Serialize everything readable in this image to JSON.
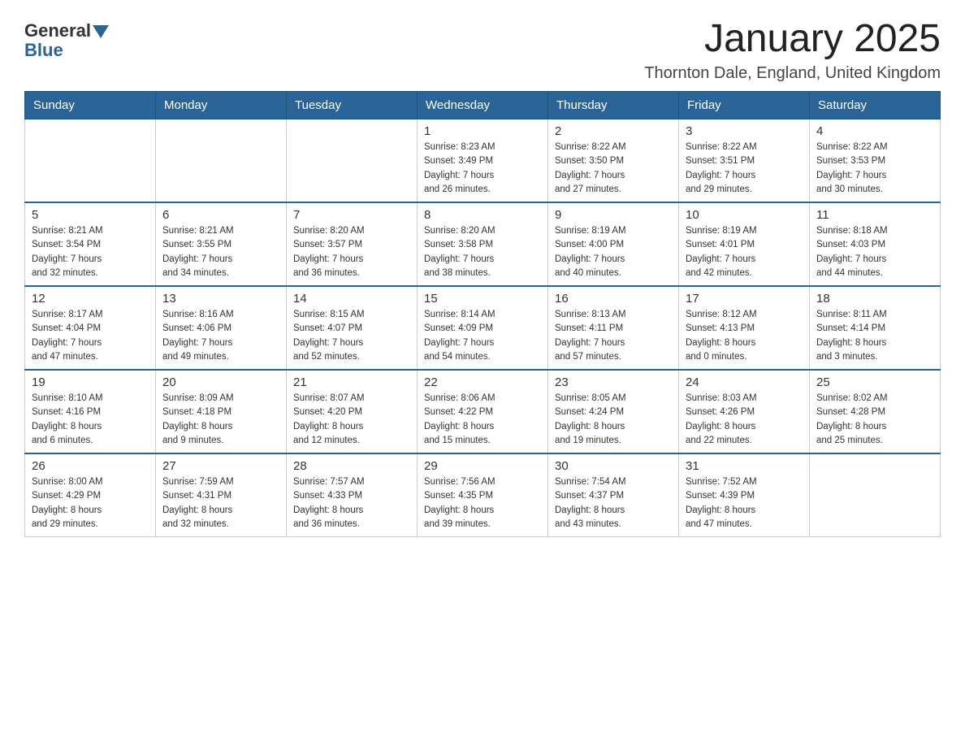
{
  "header": {
    "logo": {
      "general": "General",
      "blue": "Blue"
    },
    "title": "January 2025",
    "location": "Thornton Dale, England, United Kingdom"
  },
  "weekdays": [
    "Sunday",
    "Monday",
    "Tuesday",
    "Wednesday",
    "Thursday",
    "Friday",
    "Saturday"
  ],
  "weeks": [
    [
      {
        "day": "",
        "info": ""
      },
      {
        "day": "",
        "info": ""
      },
      {
        "day": "",
        "info": ""
      },
      {
        "day": "1",
        "info": "Sunrise: 8:23 AM\nSunset: 3:49 PM\nDaylight: 7 hours\nand 26 minutes."
      },
      {
        "day": "2",
        "info": "Sunrise: 8:22 AM\nSunset: 3:50 PM\nDaylight: 7 hours\nand 27 minutes."
      },
      {
        "day": "3",
        "info": "Sunrise: 8:22 AM\nSunset: 3:51 PM\nDaylight: 7 hours\nand 29 minutes."
      },
      {
        "day": "4",
        "info": "Sunrise: 8:22 AM\nSunset: 3:53 PM\nDaylight: 7 hours\nand 30 minutes."
      }
    ],
    [
      {
        "day": "5",
        "info": "Sunrise: 8:21 AM\nSunset: 3:54 PM\nDaylight: 7 hours\nand 32 minutes."
      },
      {
        "day": "6",
        "info": "Sunrise: 8:21 AM\nSunset: 3:55 PM\nDaylight: 7 hours\nand 34 minutes."
      },
      {
        "day": "7",
        "info": "Sunrise: 8:20 AM\nSunset: 3:57 PM\nDaylight: 7 hours\nand 36 minutes."
      },
      {
        "day": "8",
        "info": "Sunrise: 8:20 AM\nSunset: 3:58 PM\nDaylight: 7 hours\nand 38 minutes."
      },
      {
        "day": "9",
        "info": "Sunrise: 8:19 AM\nSunset: 4:00 PM\nDaylight: 7 hours\nand 40 minutes."
      },
      {
        "day": "10",
        "info": "Sunrise: 8:19 AM\nSunset: 4:01 PM\nDaylight: 7 hours\nand 42 minutes."
      },
      {
        "day": "11",
        "info": "Sunrise: 8:18 AM\nSunset: 4:03 PM\nDaylight: 7 hours\nand 44 minutes."
      }
    ],
    [
      {
        "day": "12",
        "info": "Sunrise: 8:17 AM\nSunset: 4:04 PM\nDaylight: 7 hours\nand 47 minutes."
      },
      {
        "day": "13",
        "info": "Sunrise: 8:16 AM\nSunset: 4:06 PM\nDaylight: 7 hours\nand 49 minutes."
      },
      {
        "day": "14",
        "info": "Sunrise: 8:15 AM\nSunset: 4:07 PM\nDaylight: 7 hours\nand 52 minutes."
      },
      {
        "day": "15",
        "info": "Sunrise: 8:14 AM\nSunset: 4:09 PM\nDaylight: 7 hours\nand 54 minutes."
      },
      {
        "day": "16",
        "info": "Sunrise: 8:13 AM\nSunset: 4:11 PM\nDaylight: 7 hours\nand 57 minutes."
      },
      {
        "day": "17",
        "info": "Sunrise: 8:12 AM\nSunset: 4:13 PM\nDaylight: 8 hours\nand 0 minutes."
      },
      {
        "day": "18",
        "info": "Sunrise: 8:11 AM\nSunset: 4:14 PM\nDaylight: 8 hours\nand 3 minutes."
      }
    ],
    [
      {
        "day": "19",
        "info": "Sunrise: 8:10 AM\nSunset: 4:16 PM\nDaylight: 8 hours\nand 6 minutes."
      },
      {
        "day": "20",
        "info": "Sunrise: 8:09 AM\nSunset: 4:18 PM\nDaylight: 8 hours\nand 9 minutes."
      },
      {
        "day": "21",
        "info": "Sunrise: 8:07 AM\nSunset: 4:20 PM\nDaylight: 8 hours\nand 12 minutes."
      },
      {
        "day": "22",
        "info": "Sunrise: 8:06 AM\nSunset: 4:22 PM\nDaylight: 8 hours\nand 15 minutes."
      },
      {
        "day": "23",
        "info": "Sunrise: 8:05 AM\nSunset: 4:24 PM\nDaylight: 8 hours\nand 19 minutes."
      },
      {
        "day": "24",
        "info": "Sunrise: 8:03 AM\nSunset: 4:26 PM\nDaylight: 8 hours\nand 22 minutes."
      },
      {
        "day": "25",
        "info": "Sunrise: 8:02 AM\nSunset: 4:28 PM\nDaylight: 8 hours\nand 25 minutes."
      }
    ],
    [
      {
        "day": "26",
        "info": "Sunrise: 8:00 AM\nSunset: 4:29 PM\nDaylight: 8 hours\nand 29 minutes."
      },
      {
        "day": "27",
        "info": "Sunrise: 7:59 AM\nSunset: 4:31 PM\nDaylight: 8 hours\nand 32 minutes."
      },
      {
        "day": "28",
        "info": "Sunrise: 7:57 AM\nSunset: 4:33 PM\nDaylight: 8 hours\nand 36 minutes."
      },
      {
        "day": "29",
        "info": "Sunrise: 7:56 AM\nSunset: 4:35 PM\nDaylight: 8 hours\nand 39 minutes."
      },
      {
        "day": "30",
        "info": "Sunrise: 7:54 AM\nSunset: 4:37 PM\nDaylight: 8 hours\nand 43 minutes."
      },
      {
        "day": "31",
        "info": "Sunrise: 7:52 AM\nSunset: 4:39 PM\nDaylight: 8 hours\nand 47 minutes."
      },
      {
        "day": "",
        "info": ""
      }
    ]
  ]
}
